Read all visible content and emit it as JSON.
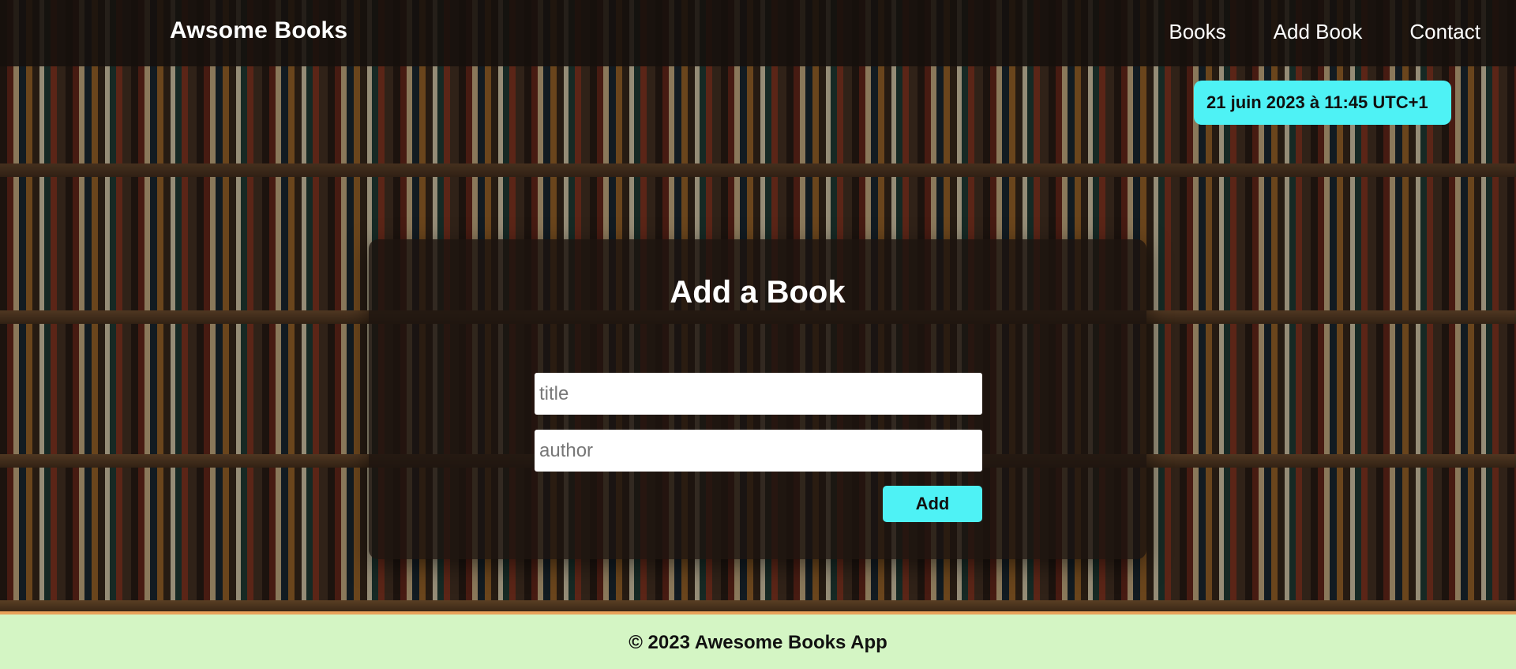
{
  "header": {
    "brand": "Awsome Books",
    "nav": {
      "books": "Books",
      "add_book": "Add Book",
      "contact": "Contact"
    }
  },
  "date_badge": {
    "text": "21 juin 2023 à 11:45 UTC+1"
  },
  "form": {
    "title": "Add a Book",
    "title_input": {
      "placeholder": "title",
      "value": ""
    },
    "author_input": {
      "placeholder": "author",
      "value": ""
    },
    "add_label": "Add"
  },
  "footer": {
    "text": "© 2023 Awesome Books App"
  },
  "colors": {
    "accent": "#4ef2f5",
    "footer_bg": "#d4f5c4",
    "header_bg": "#16100c"
  }
}
